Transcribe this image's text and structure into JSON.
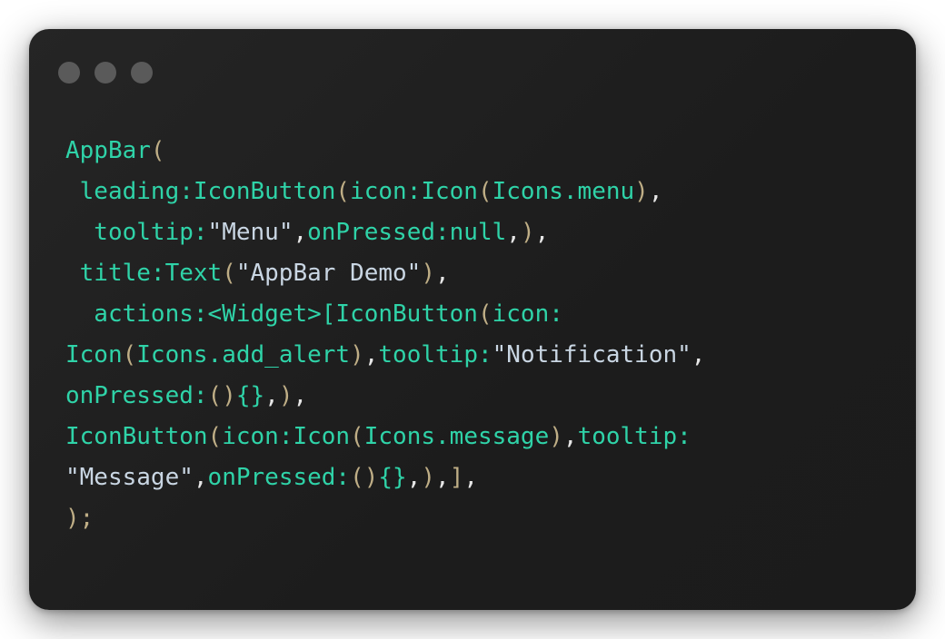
{
  "window": {
    "dots": [
      "close-dot",
      "minimize-dot",
      "maximize-dot"
    ],
    "dot_color": "#5a5a5a",
    "background": "#1e1e1e"
  },
  "colors": {
    "identifier": "#2fd3a8",
    "bracket": "#bfae86",
    "string": "#c9d6e3",
    "comma": "#e6e6e6"
  },
  "code": {
    "lines": [
      [
        {
          "t": "ident",
          "v": "AppBar"
        },
        {
          "t": "punc",
          "v": "("
        }
      ],
      [
        {
          "t": "ident",
          "v": " leading:IconButton"
        },
        {
          "t": "punc",
          "v": "("
        },
        {
          "t": "ident",
          "v": "icon:Icon"
        },
        {
          "t": "punc",
          "v": "("
        },
        {
          "t": "ident",
          "v": "Icons.menu"
        },
        {
          "t": "punc",
          "v": ")"
        },
        {
          "t": "comma",
          "v": ","
        }
      ],
      [
        {
          "t": "ident",
          "v": "  tooltip:"
        },
        {
          "t": "str",
          "v": "\"Menu\""
        },
        {
          "t": "comma",
          "v": ","
        },
        {
          "t": "ident",
          "v": "onPressed:null"
        },
        {
          "t": "comma",
          "v": ","
        },
        {
          "t": "punc",
          "v": ")"
        },
        {
          "t": "comma",
          "v": ","
        }
      ],
      [
        {
          "t": "ident",
          "v": " title:Text"
        },
        {
          "t": "punc",
          "v": "("
        },
        {
          "t": "str",
          "v": "\"AppBar Demo\""
        },
        {
          "t": "punc",
          "v": ")"
        },
        {
          "t": "comma",
          "v": ","
        }
      ],
      [
        {
          "t": "ident",
          "v": "  actions:<Widget>[IconButton"
        },
        {
          "t": "punc",
          "v": "("
        },
        {
          "t": "ident",
          "v": "icon:"
        }
      ],
      [
        {
          "t": "ident",
          "v": "Icon"
        },
        {
          "t": "punc",
          "v": "("
        },
        {
          "t": "ident",
          "v": "Icons.add_alert"
        },
        {
          "t": "punc",
          "v": ")"
        },
        {
          "t": "comma",
          "v": ","
        },
        {
          "t": "ident",
          "v": "tooltip:"
        },
        {
          "t": "str",
          "v": "\"Notification\""
        },
        {
          "t": "comma",
          "v": ","
        }
      ],
      [
        {
          "t": "ident",
          "v": "onPressed:"
        },
        {
          "t": "punc",
          "v": "()"
        },
        {
          "t": "ident",
          "v": "{}"
        },
        {
          "t": "comma",
          "v": ","
        },
        {
          "t": "punc",
          "v": ")"
        },
        {
          "t": "comma",
          "v": ","
        }
      ],
      [
        {
          "t": "ident",
          "v": "IconButton"
        },
        {
          "t": "punc",
          "v": "("
        },
        {
          "t": "ident",
          "v": "icon:Icon"
        },
        {
          "t": "punc",
          "v": "("
        },
        {
          "t": "ident",
          "v": "Icons.message"
        },
        {
          "t": "punc",
          "v": ")"
        },
        {
          "t": "comma",
          "v": ","
        },
        {
          "t": "ident",
          "v": "tooltip:"
        }
      ],
      [
        {
          "t": "str",
          "v": "\"Message\""
        },
        {
          "t": "comma",
          "v": ","
        },
        {
          "t": "ident",
          "v": "onPressed:"
        },
        {
          "t": "punc",
          "v": "()"
        },
        {
          "t": "ident",
          "v": "{}"
        },
        {
          "t": "comma",
          "v": ","
        },
        {
          "t": "punc",
          "v": ")"
        },
        {
          "t": "comma",
          "v": ","
        },
        {
          "t": "punc",
          "v": "]"
        },
        {
          "t": "comma",
          "v": ","
        }
      ],
      [
        {
          "t": "punc",
          "v": ");"
        }
      ]
    ]
  }
}
